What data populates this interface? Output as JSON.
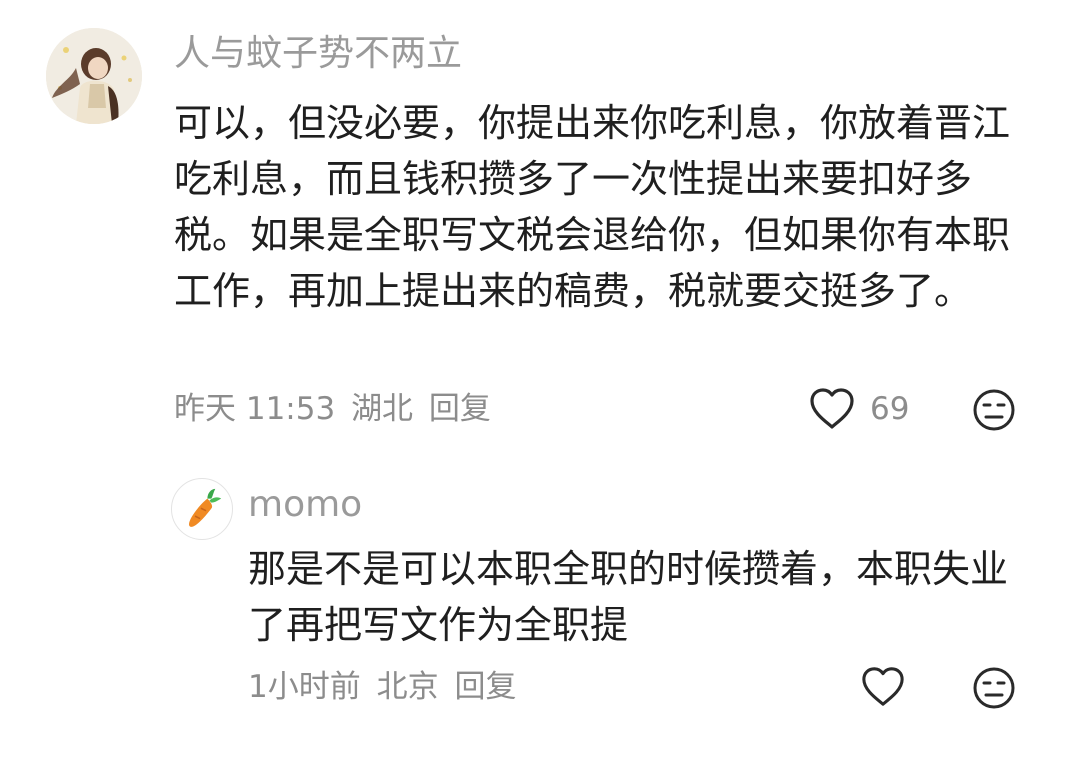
{
  "comment": {
    "avatar_icon": "user-avatar-girl-icon",
    "username": "人与蚊子势不两立",
    "text": "可以，但没必要，你提出来你吃利息，你放着晋江吃利息，而且钱积攒多了一次性提出来要扣好多税。如果是全职写文税会退给你，但如果你有本职工作，再加上提出来的稿费，税就要交挺多了。",
    "time": "昨天 11:53",
    "location": "湖北",
    "reply_label": "回复",
    "like_icon": "heart-icon",
    "like_count": "69",
    "dislike_icon": "meh-face-icon"
  },
  "reply": {
    "avatar_icon": "carrot-avatar-icon",
    "username": "momo",
    "text": "那是不是可以本职全职的时候攒着，本职失业了再把写文作为全职提",
    "time": "1小时前",
    "location": "北京",
    "reply_label": "回复",
    "like_icon": "heart-icon",
    "dislike_icon": "meh-face-icon"
  },
  "colors": {
    "text_primary": "#1f1f1f",
    "text_secondary": "#8c8c8c",
    "username": "#9a9a9a",
    "background": "#ffffff"
  }
}
